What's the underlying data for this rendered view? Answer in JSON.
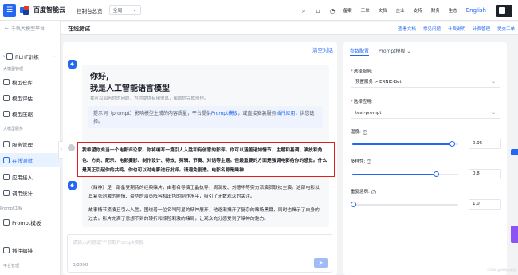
{
  "topbar": {
    "brand": "百度智能云",
    "console_link": "控制台总览",
    "region": "全局",
    "items": [
      "备案",
      "工单",
      "文档",
      "企业",
      "支持",
      "财务",
      "生态"
    ],
    "lang": "English"
  },
  "sidebar": {
    "title": "千帆大模型平台",
    "groups": [
      {
        "label": "",
        "items": [
          {
            "label": "RLHF训练",
            "active": false
          }
        ]
      },
      {
        "label": "大模型管理",
        "items": [
          {
            "label": "模型仓库",
            "active": false
          },
          {
            "label": "模型评估",
            "active": false
          },
          {
            "label": "模型压缩",
            "active": false
          }
        ]
      },
      {
        "label": "大模型服务",
        "items": [
          {
            "label": "服务管理",
            "active": false
          },
          {
            "label": "在线测试",
            "active": true
          },
          {
            "label": "应用接入",
            "active": false
          },
          {
            "label": "调用统计",
            "active": false
          }
        ]
      },
      {
        "label": "Prompt工程",
        "items": [
          {
            "label": "Prompt模板",
            "active": false
          },
          {
            "label": "插件编排",
            "active": false
          }
        ]
      },
      {
        "label": "平台管理",
        "items": []
      }
    ]
  },
  "page": {
    "title": "在线测试",
    "links": [
      "查看文档",
      "常见问题",
      "计费说明",
      "计费管理",
      "提交工单"
    ]
  },
  "chat": {
    "clear_label": "清空对话",
    "welcome": {
      "line1": "你好,",
      "line2": "我是人工智能语言模型",
      "sub": "我可以回答你的问题，为你提供有用信息，帮助你完成创作。",
      "tip_prefix": "提示词（prompt）影响模型生成的内容质量，平台提供",
      "tip_link1": "Prompt模板",
      "tip_mid": "，或直接安装服务",
      "tip_link2": "插件应用",
      "tip_suffix": "，供您选择。"
    },
    "user_message": "我希望你充当一个电影评论家。你将编写一篇引人入胜和有创意的影评。你可以涵盖诸如情节、主题和基调、演技和角色、方向、配乐、电影摄影、制作设计、特效、剪辑、节奏、对话等主题。但最重要的方面是强调电影给你的感觉。什么是真正引起你的共鸣。你也可以对电影进行批评。请避免剧透。电影名称是赌神",
    "reply_paragraphs": [
      "《赌神》是一部备受期待的经典赌片，由著名导演王晶执导，周润发、刘德华等实力派演员联袂主演。这部电影以其紧张刺激的剧情、豪华的演员阵容和出色的制作水平，吸引了无数观众的关注。",
      "故事情节紧凑且引人入胜，围绕着一位名叫阿星的赌神展开，他逐渐揭开了复杂的赌场黑幕，同时也揭示了自身的过去。影片充满了意想不到的转折和惊险刺激的赌局，让观众充分感受到了赌神的魅力。"
    ],
    "input_placeholder": "请输入问题或\"/\"获取Prompt模板",
    "counter": "0/2000"
  },
  "panel": {
    "tabs": [
      "参数配置",
      "Prompt模板"
    ],
    "service_label": "选择服务:",
    "service_value": "预置服务 > ERNIE-Bot",
    "app_label": "选择应用:",
    "app_value": "test-prompt",
    "params": [
      {
        "label": "温度:",
        "value": "0.95",
        "level": 0.95
      },
      {
        "label": "多样性:",
        "value": "0.8",
        "level": 0.8
      },
      {
        "label": "重复惩罚:",
        "value": "1.0",
        "level": 0.0
      }
    ]
  },
  "watermark": "CSDN @AI码农老张",
  "colors": {
    "accent": "#2468f2",
    "highlight_border": "#e02020"
  }
}
